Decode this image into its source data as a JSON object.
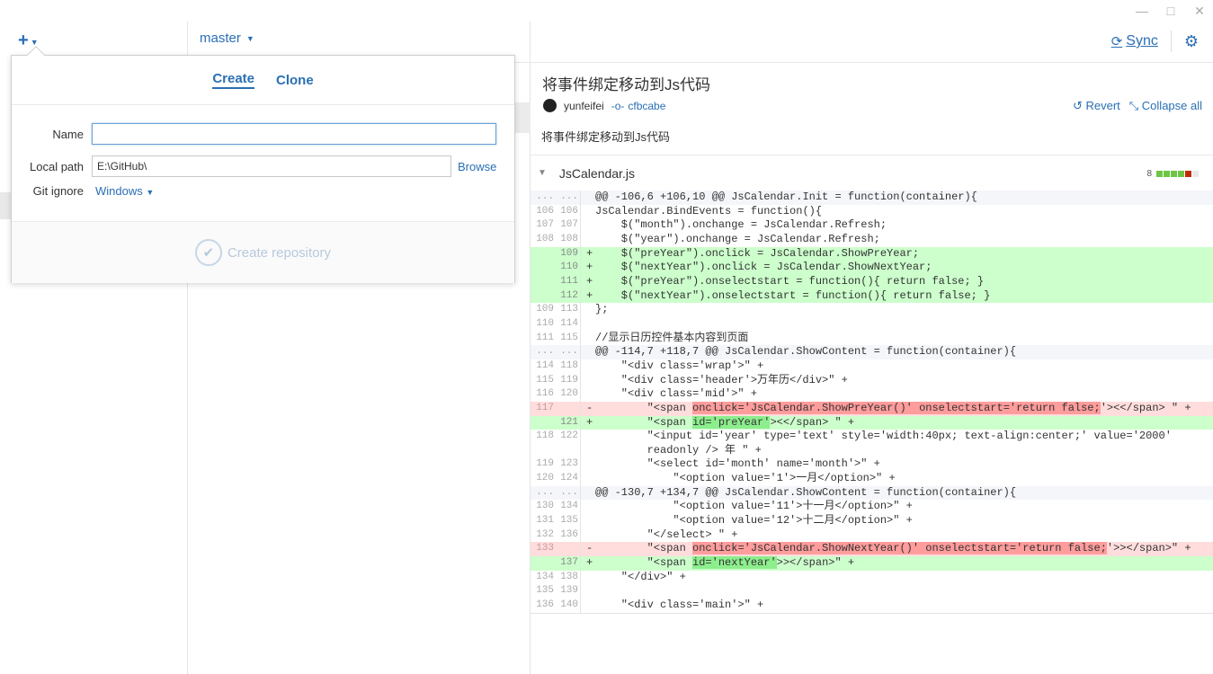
{
  "window": {
    "minimize": "—",
    "maximize": "□",
    "close": "✕"
  },
  "toolbar": {
    "plus": "+",
    "branch": "master",
    "sync_label": "Sync"
  },
  "popover": {
    "tabs": [
      "Create",
      "Clone"
    ],
    "name_label": "Name",
    "name_value": "",
    "local_path_label": "Local path",
    "local_path_value": "E:\\GitHub\\",
    "browse": "Browse",
    "gitignore_label": "Git ignore",
    "gitignore_value": "Windows",
    "create_button": "Create repository"
  },
  "commit": {
    "title": "将事件绑定移动到Js代码",
    "author": "yunfeifei",
    "sha": "cfbcabe",
    "revert": "Revert",
    "collapse": "Collapse all",
    "message": "将事件绑定移动到Js代码"
  },
  "file": {
    "name": "JsCalendar.js",
    "changes": "8",
    "stat_colors": [
      "#6cc644",
      "#6cc644",
      "#6cc644",
      "#6cc644",
      "#bd2c00",
      "#e8e8e8"
    ]
  },
  "diff": [
    {
      "t": "hunk",
      "a": "...",
      "b": "...",
      "m": "",
      "c": "@@ -106,6 +106,10 @@ JsCalendar.Init = function(container){"
    },
    {
      "t": "ctx",
      "a": "106",
      "b": "106",
      "m": "",
      "c": "JsCalendar.BindEvents = function(){"
    },
    {
      "t": "ctx",
      "a": "107",
      "b": "107",
      "m": "",
      "c": "    $(\"month\").onchange = JsCalendar.Refresh;"
    },
    {
      "t": "ctx",
      "a": "108",
      "b": "108",
      "m": "",
      "c": "    $(\"year\").onchange = JsCalendar.Refresh;"
    },
    {
      "t": "add",
      "a": "",
      "b": "109",
      "m": "+",
      "c": "    $(\"preYear\").onclick = JsCalendar.ShowPreYear;"
    },
    {
      "t": "add",
      "a": "",
      "b": "110",
      "m": "+",
      "c": "    $(\"nextYear\").onclick = JsCalendar.ShowNextYear;"
    },
    {
      "t": "add",
      "a": "",
      "b": "111",
      "m": "+",
      "c": "    $(\"preYear\").onselectstart = function(){ return false; }"
    },
    {
      "t": "add",
      "a": "",
      "b": "112",
      "m": "+",
      "c": "    $(\"nextYear\").onselectstart = function(){ return false; }"
    },
    {
      "t": "ctx",
      "a": "109",
      "b": "113",
      "m": "",
      "c": "};"
    },
    {
      "t": "ctx",
      "a": "110",
      "b": "114",
      "m": "",
      "c": ""
    },
    {
      "t": "ctx",
      "a": "111",
      "b": "115",
      "m": "",
      "c": "//显示日历控件基本内容到页面"
    },
    {
      "t": "hunk",
      "a": "...",
      "b": "...",
      "m": "",
      "c": "@@ -114,7 +118,7 @@ JsCalendar.ShowContent = function(container){"
    },
    {
      "t": "ctx",
      "a": "114",
      "b": "118",
      "m": "",
      "c": "    \"<div class='wrap'>\" +"
    },
    {
      "t": "ctx",
      "a": "115",
      "b": "119",
      "m": "",
      "c": "    \"<div class='header'>万年历</div>\" +"
    },
    {
      "t": "ctx",
      "a": "116",
      "b": "120",
      "m": "",
      "c": "    \"<div class='mid'>\" +"
    },
    {
      "t": "del",
      "a": "117",
      "b": "",
      "m": "-",
      "pre": "        \"<span ",
      "hl": "onclick='JsCalendar.ShowPreYear()' onselectstart='return false;",
      "post": "'><</span> \" +"
    },
    {
      "t": "add",
      "a": "",
      "b": "121",
      "m": "+",
      "pre": "        \"<span ",
      "hl": "id='preYear'",
      "post": "><</span> \" +"
    },
    {
      "t": "ctx",
      "a": "118",
      "b": "122",
      "m": "",
      "c": "        \"<input id='year' type='text' style='width:40px; text-align:center;' value='2000'"
    },
    {
      "t": "ctx",
      "a": "",
      "b": "",
      "m": "",
      "c": "        readonly /> 年 \" +"
    },
    {
      "t": "ctx",
      "a": "119",
      "b": "123",
      "m": "",
      "c": "        \"<select id='month' name='month'>\" +"
    },
    {
      "t": "ctx",
      "a": "120",
      "b": "124",
      "m": "",
      "c": "            \"<option value='1'>一月</option>\" +"
    },
    {
      "t": "hunk",
      "a": "...",
      "b": "...",
      "m": "",
      "c": "@@ -130,7 +134,7 @@ JsCalendar.ShowContent = function(container){"
    },
    {
      "t": "ctx",
      "a": "130",
      "b": "134",
      "m": "",
      "c": "            \"<option value='11'>十一月</option>\" +"
    },
    {
      "t": "ctx",
      "a": "131",
      "b": "135",
      "m": "",
      "c": "            \"<option value='12'>十二月</option>\" +"
    },
    {
      "t": "ctx",
      "a": "132",
      "b": "136",
      "m": "",
      "c": "        \"</select> \" +"
    },
    {
      "t": "del",
      "a": "133",
      "b": "",
      "m": "-",
      "pre": "        \"<span ",
      "hl": "onclick='JsCalendar.ShowNextYear()' onselectstart='return false;",
      "post": "'>></span>\" +"
    },
    {
      "t": "add",
      "a": "",
      "b": "137",
      "m": "+",
      "pre": "        \"<span ",
      "hl": "id='nextYear'",
      "post": ">></span>\" +"
    },
    {
      "t": "ctx",
      "a": "134",
      "b": "138",
      "m": "",
      "c": "    \"</div>\" +"
    },
    {
      "t": "ctx",
      "a": "135",
      "b": "139",
      "m": "",
      "c": ""
    },
    {
      "t": "ctx",
      "a": "136",
      "b": "140",
      "m": "",
      "c": "    \"<div class='main'>\" +"
    }
  ]
}
